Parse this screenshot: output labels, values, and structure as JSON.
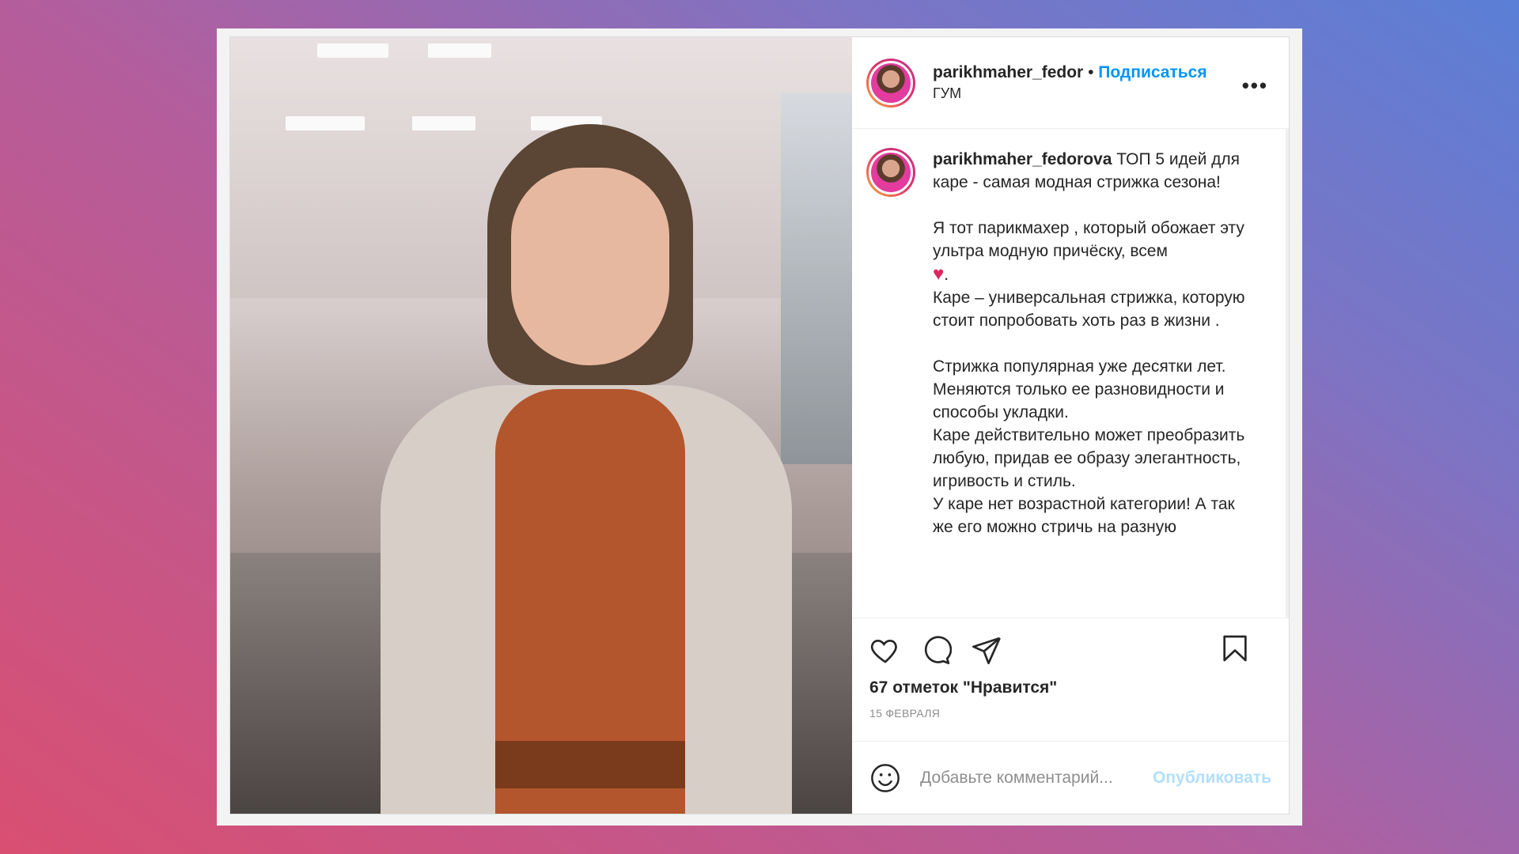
{
  "post": {
    "author_header": "parikhmaher_fedor",
    "separator": "•",
    "follow_label": "Подписаться",
    "location": "ГУМ",
    "more_label": "•••",
    "caption_user": "parikhmaher_fedorova",
    "caption_lines": [
      " ТОП 5 идей для каре - самая модная стрижка сезона!",
      "",
      "Я тот парикмахер , который обожает эту ультра модную причёску, всем",
      "HEART",
      "Каре – универсальная стрижка, которую стоит попробовать хоть раз в жизни .",
      "",
      "Стрижка популярная уже десятки лет. Меняются только ее разновидности и способы укладки.",
      "Каре действительно может преобразить любую, придав ее образу элегантность, игривость и стиль.",
      "У каре нет возрастной категории! А так же его можно стричь на разную"
    ],
    "heart_emoji": "♥",
    "heart_suffix": ".",
    "likes": "67 отметок \"Нравится\"",
    "date": "15 ФЕВРАЛЯ",
    "comment_placeholder": "Добавьте комментарий...",
    "publish_label": "Опубликовать"
  },
  "colors": {
    "accent": "#0095f6",
    "publish_disabled": "#b2dffc",
    "heart": "#e0245e"
  },
  "icons": [
    "heart-icon",
    "comment-icon",
    "share-icon",
    "bookmark-icon",
    "emoji-icon",
    "more-icon"
  ]
}
